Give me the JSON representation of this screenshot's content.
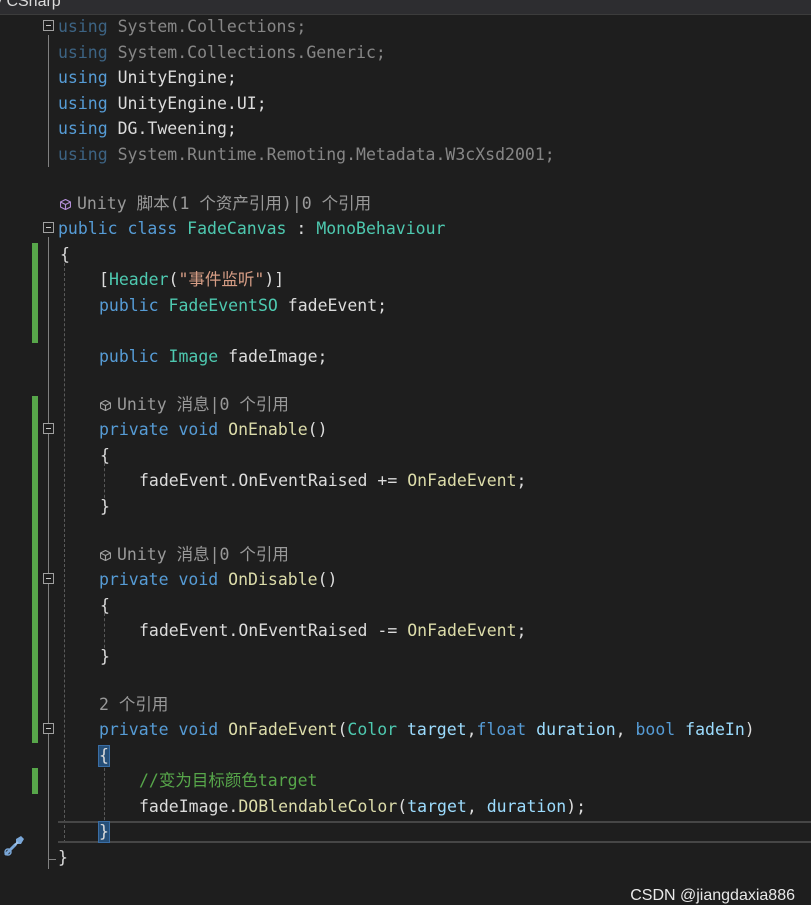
{
  "window": {
    "title_fragment": "y CSharp"
  },
  "usings": [
    {
      "kw": "using",
      "ns": "System.Collections",
      "semi": ";",
      "dim": true
    },
    {
      "kw": "using",
      "ns": "System.Collections.Generic",
      "semi": ";",
      "dim": true
    },
    {
      "kw": "using",
      "ns": "UnityEngine",
      "semi": ";",
      "dim": false
    },
    {
      "kw": "using",
      "ns": "UnityEngine.UI",
      "semi": ";",
      "dim": false
    },
    {
      "kw": "using",
      "ns": "DG.Tweening",
      "semi": ";",
      "dim": false
    },
    {
      "kw": "using",
      "ns": "System.Runtime.Remoting.Metadata.W3cXsd2001",
      "semi": ";",
      "dim": true
    }
  ],
  "codelens": {
    "class": "Unity 脚本(1 个资产引用)|0 个引用",
    "onenable": "Unity 消息|0 个引用",
    "ondisable": "Unity 消息|0 个引用",
    "onfade": "2 个引用"
  },
  "class_decl": {
    "mod": "public",
    "kw": "class",
    "name": "FadeCanvas",
    "colon": " : ",
    "base": "MonoBehaviour"
  },
  "attribute": {
    "open": "[",
    "name": "Header",
    "paren_open": "(",
    "arg": "\"事件监听\"",
    "close": ")]"
  },
  "fields": [
    {
      "mod": "public",
      "type": "FadeEventSO",
      "name": " fadeEvent;"
    },
    {
      "mod": "public",
      "type": "Image",
      "name": " fadeImage;"
    }
  ],
  "methods": {
    "onenable": {
      "mod": "private",
      "ret": "void",
      "name": "OnEnable",
      "params": "()",
      "body": {
        "obj": "fadeEvent",
        "dot": ".",
        "member": "OnEventRaised",
        "op": " += ",
        "handler": "OnFadeEvent",
        "semi": ";"
      }
    },
    "ondisable": {
      "mod": "private",
      "ret": "void",
      "name": "OnDisable",
      "params": "()",
      "body": {
        "obj": "fadeEvent",
        "dot": ".",
        "member": "OnEventRaised",
        "op": " -= ",
        "handler": "OnFadeEvent",
        "semi": ";"
      }
    },
    "onfade": {
      "mod": "private",
      "ret": "void",
      "name": "OnFadeEvent",
      "open": "(",
      "p1type": "Color",
      "p1name": " target",
      "comma1": ",",
      "p2type": "float",
      "p2name": " duration",
      "comma2": ", ",
      "p3type": "bool",
      "p3name": " fadeIn",
      "close": ")",
      "comment": "//变为目标颜色target",
      "call_obj": "fadeImage",
      "call_dot": ".",
      "call_method": "DOBlendableColor",
      "call_open": "(",
      "call_arg1": "target",
      "call_comma": ", ",
      "call_arg2": "duration",
      "call_close": ");"
    }
  },
  "braces": {
    "open": "{",
    "close": "}"
  },
  "watermark": "CSDN @jiangdaxia886"
}
